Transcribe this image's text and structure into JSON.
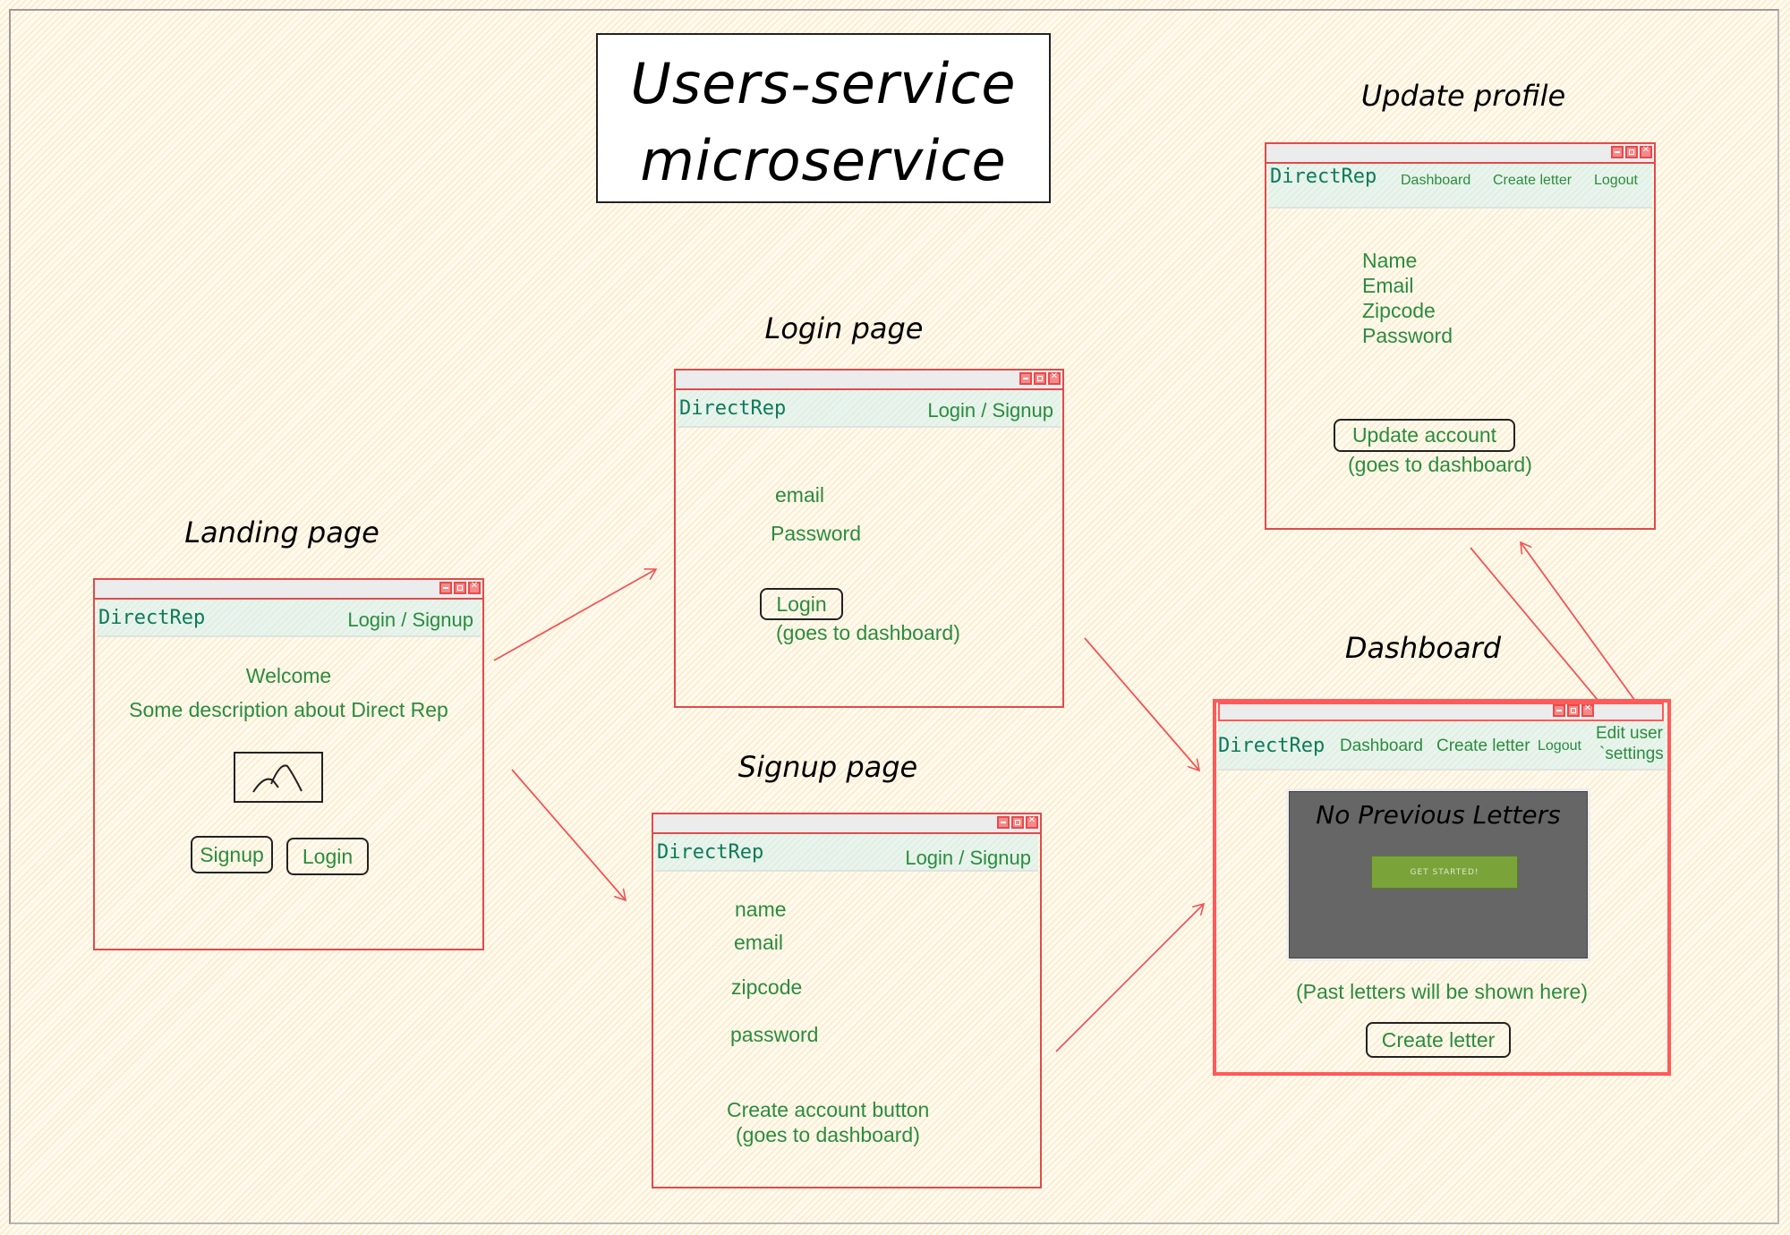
{
  "diagram_title": {
    "line1": "Users-service",
    "line2": "microservice"
  },
  "brand": "DirectRep",
  "colors": {
    "window_border": "#e24a4a",
    "text_green": "#2a8c3e",
    "brand_teal": "#0d7a5a",
    "panel_gray": "#666666",
    "get_started_green": "#7aa33a"
  },
  "window_controls": [
    "minimize-icon",
    "maximize-icon",
    "close-icon"
  ],
  "landing": {
    "label": "Landing page",
    "nav_right": "Login / Signup",
    "welcome": "Welcome",
    "description": "Some description about Direct Rep",
    "image_icon": "image-placeholder-icon",
    "signup_button": "Signup",
    "login_button": "Login"
  },
  "login": {
    "label": "Login page",
    "nav_right": "Login / Signup",
    "fields": [
      "email",
      "Password"
    ],
    "login_button": "Login",
    "note": "(goes to dashboard)"
  },
  "signup": {
    "label": "Signup page",
    "nav_right": "Login / Signup",
    "fields": [
      "name",
      "email",
      "zipcode",
      "password"
    ],
    "create_account": "Create account button",
    "note": "(goes to dashboard)"
  },
  "update_profile": {
    "label": "Update profile",
    "nav": [
      "Dashboard",
      "Create letter",
      "Logout"
    ],
    "fields": [
      "Name",
      "Email",
      "Zipcode",
      "Password"
    ],
    "update_button": "Update account",
    "note": "(goes to dashboard)"
  },
  "dashboard": {
    "label": "Dashboard",
    "nav": [
      "Dashboard",
      "Create letter",
      "Logout"
    ],
    "edit_settings_line1": "Edit user",
    "edit_settings_line2": "`settings",
    "panel_heading": "No Previous Letters",
    "get_started": "GET STARTED!",
    "past_letters_note": "(Past letters will be shown here)",
    "create_letter_button": "Create letter"
  },
  "arrows": [
    {
      "from": "landing",
      "to": "login"
    },
    {
      "from": "landing",
      "to": "signup"
    },
    {
      "from": "login",
      "to": "dashboard"
    },
    {
      "from": "signup",
      "to": "dashboard"
    },
    {
      "from": "update_profile",
      "to": "dashboard"
    },
    {
      "from": "dashboard",
      "to": "update_profile"
    }
  ]
}
